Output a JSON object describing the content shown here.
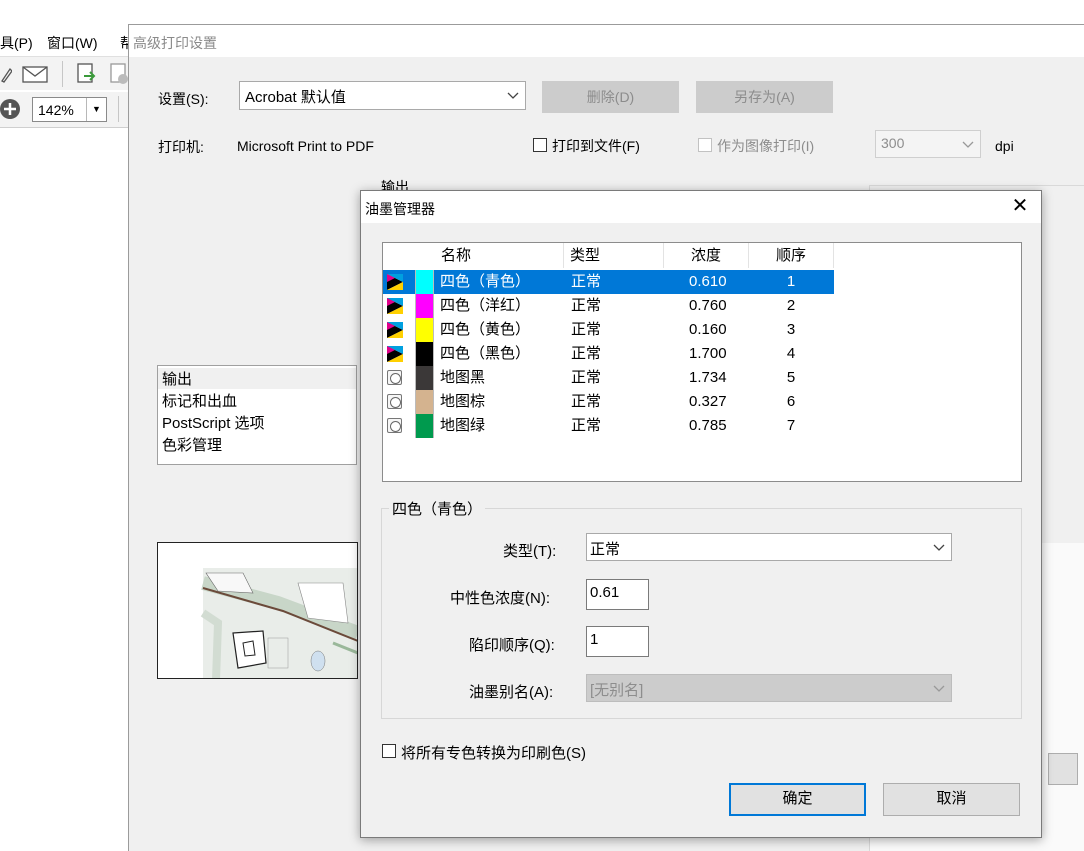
{
  "background_app": {
    "menu": [
      "具(P)",
      "窗口(W)",
      "帮"
    ],
    "zoom": "142%"
  },
  "advanced_print": {
    "title": "高级打印设置",
    "settings_label": "设置(S):",
    "settings_value": "Acrobat 默认值",
    "delete_button": "删除(D)",
    "save_as_button": "另存为(A)",
    "printer_label": "打印机:",
    "printer_value": "Microsoft Print to PDF",
    "print_to_file": "打印到文件(F)",
    "print_as_image": "作为图像打印(I)",
    "dpi_value": "300",
    "dpi_unit": "dpi",
    "output_heading": "输出",
    "categories": [
      {
        "label": "输出",
        "selected": true
      },
      {
        "label": "标记和出血",
        "selected": false
      },
      {
        "label": "PostScript 选项",
        "selected": false
      },
      {
        "label": "色彩管理",
        "selected": false
      }
    ]
  },
  "ink_manager": {
    "title": "油墨管理器",
    "close_glyph": "✕",
    "columns": {
      "name": "名称",
      "type": "类型",
      "density": "浓度",
      "order": "顺序"
    },
    "inks": [
      {
        "kind": "process",
        "swatch": "#00ffff",
        "name": "四色（青色）",
        "type": "正常",
        "density": "0.610",
        "order": "1",
        "selected": true
      },
      {
        "kind": "process",
        "swatch": "#ff00ff",
        "name": "四色（洋红）",
        "type": "正常",
        "density": "0.760",
        "order": "2",
        "selected": false
      },
      {
        "kind": "process",
        "swatch": "#ffff00",
        "name": "四色（黄色）",
        "type": "正常",
        "density": "0.160",
        "order": "3",
        "selected": false
      },
      {
        "kind": "process",
        "swatch": "#000000",
        "name": "四色（黑色）",
        "type": "正常",
        "density": "1.700",
        "order": "4",
        "selected": false
      },
      {
        "kind": "spot",
        "swatch": "#3b3838",
        "name": "地图黑",
        "type": "正常",
        "density": "1.734",
        "order": "5",
        "selected": false
      },
      {
        "kind": "spot",
        "swatch": "#d4b38f",
        "name": "地图棕",
        "type": "正常",
        "density": "0.327",
        "order": "6",
        "selected": false
      },
      {
        "kind": "spot",
        "swatch": "#009a4e",
        "name": "地图绿",
        "type": "正常",
        "density": "0.785",
        "order": "7",
        "selected": false
      }
    ],
    "detail": {
      "group_title": "四色（青色）",
      "type_label": "类型(T):",
      "type_value": "正常",
      "density_label": "中性色浓度(N):",
      "density_value": "0.61",
      "trap_label": "陷印顺序(Q):",
      "trap_value": "1",
      "alias_label": "油墨别名(A):",
      "alias_value": "[无别名]"
    },
    "convert_spots": "将所有专色转换为印刷色(S)",
    "ok_button": "确定",
    "cancel_button": "取消"
  }
}
